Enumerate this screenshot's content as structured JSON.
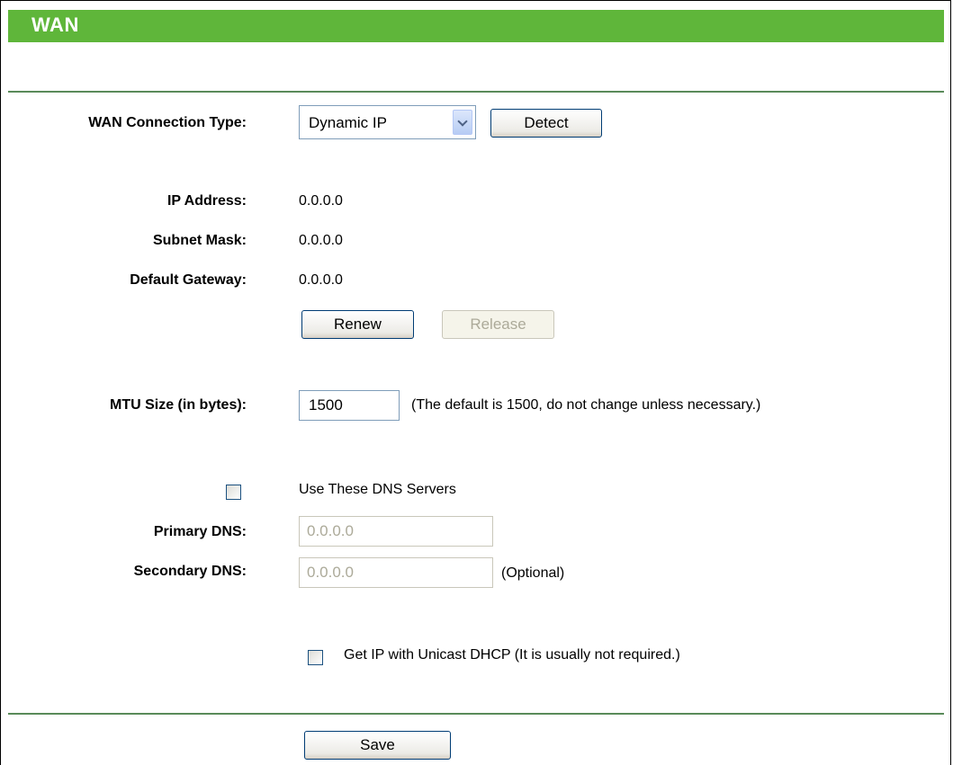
{
  "header": {
    "title": "WAN"
  },
  "wan": {
    "type_label": "WAN Connection Type:",
    "type_value": "Dynamic IP",
    "detect_label": "Detect"
  },
  "status": {
    "ip_label": "IP Address:",
    "ip_value": "0.0.0.0",
    "mask_label": "Subnet Mask:",
    "mask_value": "0.0.0.0",
    "gateway_label": "Default Gateway:",
    "gateway_value": "0.0.0.0",
    "renew_label": "Renew",
    "release_label": "Release"
  },
  "mtu": {
    "label": "MTU Size (in bytes):",
    "value": "1500",
    "hint": "(The default is 1500, do not change unless necessary.)"
  },
  "dns": {
    "use_label": "Use These DNS Servers",
    "primary_label": "Primary DNS:",
    "primary_value": "0.0.0.0",
    "secondary_label": "Secondary DNS:",
    "secondary_value": "0.0.0.0",
    "optional": "(Optional)"
  },
  "unicast": {
    "label": "Get IP with Unicast DHCP (It is usually not required.)"
  },
  "footer": {
    "save_label": "Save"
  },
  "colors": {
    "header_green": "#5fb63a",
    "divider": "#5a8b5a"
  }
}
